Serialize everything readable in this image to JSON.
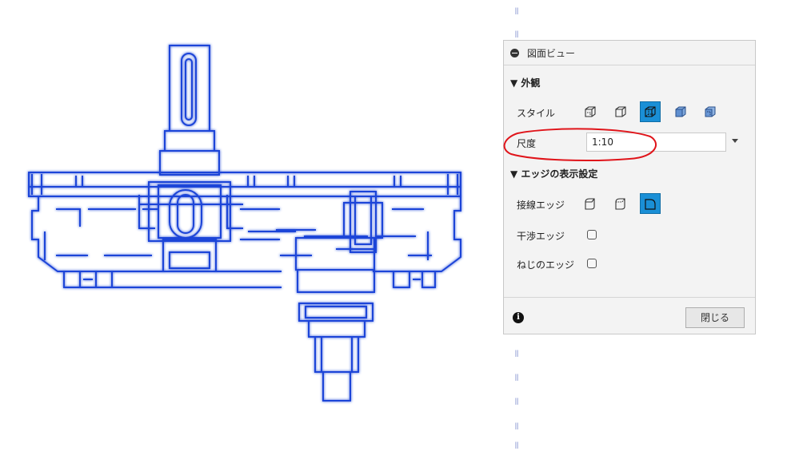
{
  "panel": {
    "title": "図面ビュー",
    "appearance_section": "▼ 外観",
    "style_label": "スタイル",
    "scale_label": "尺度",
    "scale_value": "1:10",
    "edge_section": "▼ エッジの表示設定",
    "tangent_edges_label": "接線エッジ",
    "interference_edges_label": "干渉エッジ",
    "thread_edges_label": "ねじのエッジ",
    "close_label": "閉じる",
    "info_glyph": "i",
    "style_icons": [
      "visible-edges-icon",
      "visible-hidden-icon",
      "hidden-edges-active-icon",
      "shaded-icon",
      "shaded-hidden-icon"
    ],
    "tangent_icons": [
      "tangent-off-icon",
      "tangent-partial-icon",
      "tangent-full-active-icon"
    ],
    "accent_color": "#1a8fd6",
    "annotation_color": "#e0141a",
    "drawing_color": "#1e44d8"
  },
  "side_dots": [
    "⦀",
    "⦀",
    "⦀",
    "⦀",
    "⦀",
    "⦀",
    "⦀"
  ]
}
